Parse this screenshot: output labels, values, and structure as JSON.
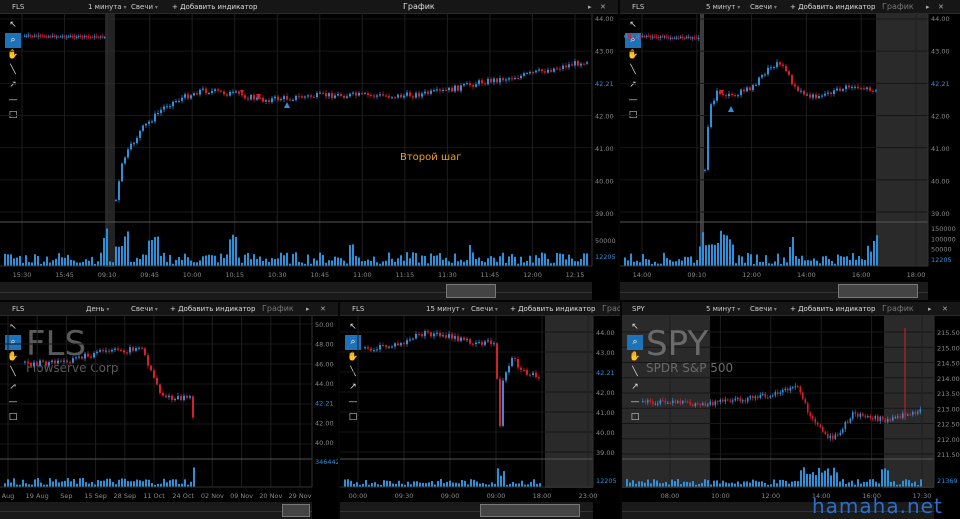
{
  "panels": [
    {
      "id": "p1",
      "header": {
        "symbol": "FLS",
        "interval": "1 минута",
        "style": "Свечи",
        "add": "+ Добавить индикатор",
        "title": "График"
      },
      "price_ticks": [
        "44.00",
        "43.00",
        "42.21",
        "42.00",
        "41.00",
        "40.00",
        "39.00"
      ],
      "volume_ticks": [
        "50000",
        "12205"
      ],
      "time_ticks": [
        "15:30",
        "15:45",
        "09:10",
        "09:45",
        "10:00",
        "10:15",
        "10:30",
        "10:45",
        "11:00",
        "11:15",
        "11:30",
        "11:45",
        "12:00",
        "12:15"
      ],
      "annotation": "Второй шаг"
    },
    {
      "id": "p2",
      "header": {
        "symbol": "FLS",
        "interval": "5 минут",
        "style": "Свечи",
        "add": "+ Добавить индикатор",
        "title": "График"
      },
      "price_ticks": [
        "44.00",
        "43.00",
        "42.21",
        "42.00",
        "41.00",
        "40.00",
        "39.00"
      ],
      "volume_ticks": [
        "150000",
        "100000",
        "50000",
        "12205"
      ],
      "time_ticks": [
        "14:00",
        "09:10",
        "12:00",
        "14:00",
        "16:00",
        "18:00"
      ]
    },
    {
      "id": "p3",
      "header": {
        "symbol": "FLS",
        "interval": "День",
        "style": "Свечи",
        "add": "+ Добавить индикатор",
        "title": "График"
      },
      "watermark": {
        "symbol": "FLS",
        "name": "Flowserve Corp"
      },
      "price_ticks": [
        "50.00",
        "48.00",
        "46.00",
        "44.00",
        "42.21",
        "42.00",
        "40.00"
      ],
      "volume_ticks": [
        "3464425"
      ],
      "time_ticks": [
        "Aug",
        "19 Aug",
        "Sep",
        "15 Sep",
        "28 Sep",
        "11 Oct",
        "24 Oct",
        "02 Nov",
        "09 Nov",
        "20 Nov",
        "29 Nov"
      ]
    },
    {
      "id": "p4",
      "header": {
        "symbol": "FLS",
        "interval": "15 минут",
        "style": "Свечи",
        "add": "+ Добавить индикатор",
        "title": "График"
      },
      "price_ticks": [
        "44.00",
        "43.00",
        "42.21",
        "42.00",
        "41.00",
        "40.00",
        "39.00"
      ],
      "volume_ticks": [
        "12205"
      ],
      "time_ticks": [
        "00:00",
        "09:30",
        "09:00",
        "09:00",
        "18:00",
        "23:00"
      ]
    },
    {
      "id": "p5",
      "header": {
        "symbol": "SPY",
        "interval": "5 минут",
        "style": "Свечи",
        "add": "+ Добавить индикатор",
        "title": "График"
      },
      "watermark": {
        "symbol": "SPY",
        "name": "SPDR S&P 500"
      },
      "price_ticks": [
        "215.50",
        "215.00",
        "214.50",
        "214.00",
        "213.50",
        "213.00",
        "212.50",
        "212.00",
        "211.50"
      ],
      "volume_ticks": [
        "21369"
      ],
      "time_ticks": [
        "08:00",
        "10:00",
        "12:00",
        "14:00",
        "16:00",
        "17:30"
      ]
    }
  ],
  "site_watermark": "hamaha.net",
  "colors": {
    "up": "#2f8fd8",
    "down": "#d4202a",
    "background": "#000000",
    "grid": "#1c1c1c",
    "annotation": "#f0a020",
    "price_label": "#2f8fd8"
  }
}
